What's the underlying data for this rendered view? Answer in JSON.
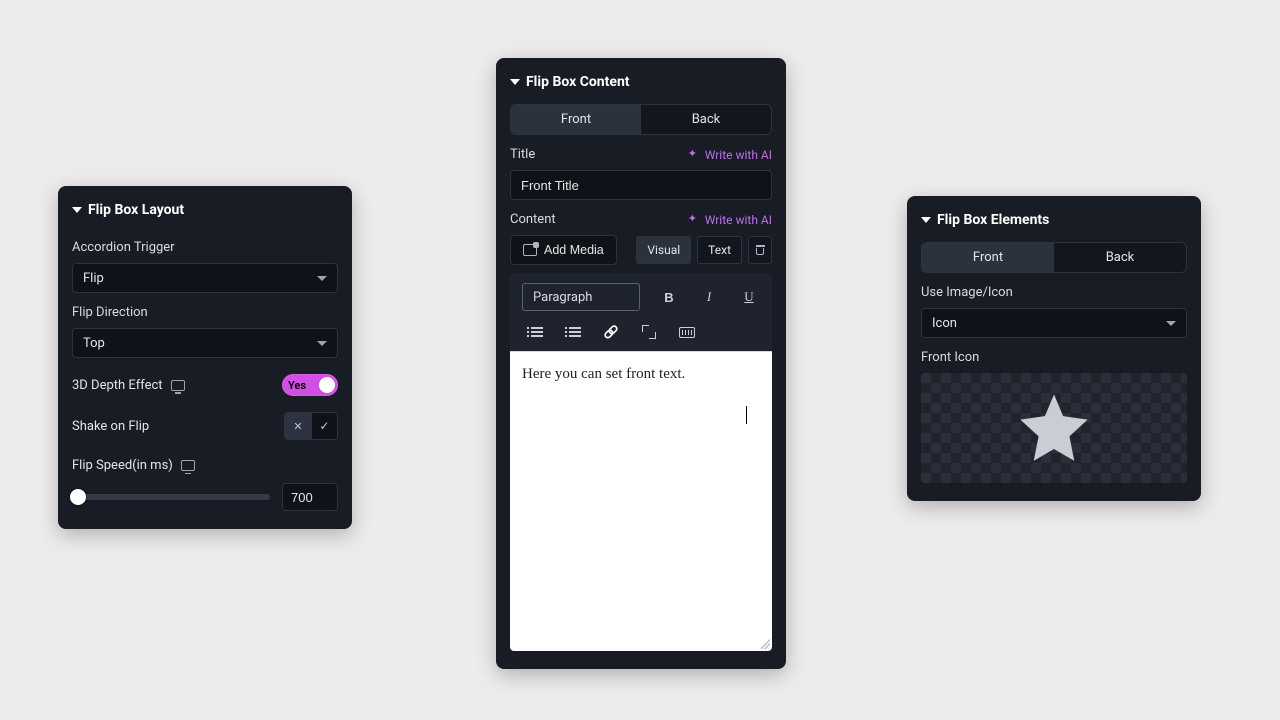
{
  "layout": {
    "title": "Flip Box Layout",
    "accordion_label": "Accordion Trigger",
    "accordion_value": "Flip",
    "direction_label": "Flip Direction",
    "direction_value": "Top",
    "depth_label": "3D Depth Effect",
    "depth_toggle_text": "Yes",
    "shake_label": "Shake on Flip",
    "speed_label": "Flip Speed(in ms)",
    "speed_value": "700"
  },
  "content": {
    "title": "Flip Box Content",
    "tabs": {
      "front": "Front",
      "back": "Back"
    },
    "title_label": "Title",
    "ai_link": "Write with AI",
    "title_value": "Front Title",
    "content_label": "Content",
    "add_media": "Add Media",
    "mode_visual": "Visual",
    "mode_text": "Text",
    "para_select": "Paragraph",
    "editor_text": "Here you can set front text.",
    "toolbar": {
      "bold": "B",
      "italic": "I",
      "underline": "U"
    }
  },
  "elements": {
    "title": "Flip Box Elements",
    "tabs": {
      "front": "Front",
      "back": "Back"
    },
    "use_label": "Use Image/Icon",
    "use_value": "Icon",
    "front_icon_label": "Front Icon"
  }
}
